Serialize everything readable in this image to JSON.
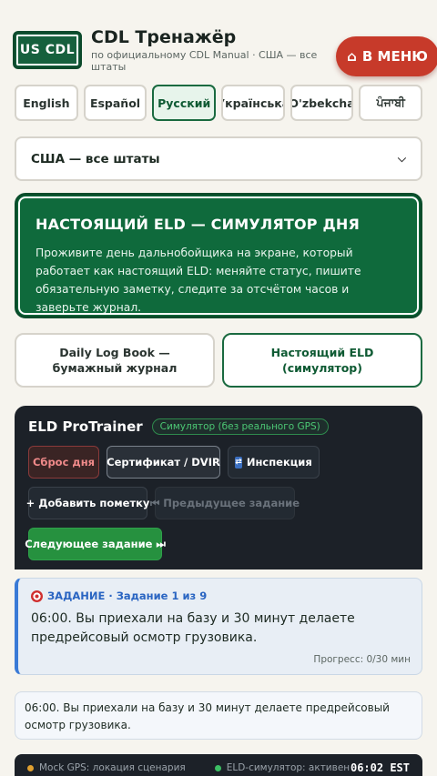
{
  "header": {
    "logo": "US CDL",
    "title": "CDL Тренажёр",
    "subtitle": "по официальному CDL Manual · США — все штаты",
    "menu_label": "В МЕНЮ",
    "menu_icon": "home-icon"
  },
  "languages": [
    {
      "label": "English",
      "active": false
    },
    {
      "label": "Español",
      "active": false
    },
    {
      "label": "Русский",
      "active": true
    },
    {
      "label": "Українська",
      "active": false
    },
    {
      "label": "O'zbekcha",
      "active": false
    },
    {
      "label": "ਪੰਜਾਬੀ",
      "active": false
    }
  ],
  "state_select": {
    "value": "США — все штаты"
  },
  "hero": {
    "title": "НАСТОЯЩИЙ ELD — СИМУЛЯТОР ДНЯ",
    "text": "Проживите день дальнобойщика на экране, который работает как настоящий ELD: меняйте статус, пишите обязательную заметку, следите за отсчётом часов и заверьте журнал."
  },
  "modes": {
    "paper": "Daily Log Book — бумажный журнал",
    "eld": "Настоящий ELD (симулятор)"
  },
  "eld": {
    "title": "ELD ProTrainer",
    "badge": "Симулятор (без реального GPS)",
    "reset": "Сброс дня",
    "cert": "Сертификат / DVIR",
    "inspection": "Инспекция",
    "add_note": "+ Добавить пометку",
    "prev": "⏮ Предыдущее задание",
    "next": "Следующее задание ⏭"
  },
  "task": {
    "heading": "ЗАДАНИЕ · Задание 1 из 9",
    "text": "06:00. Вы приехали на базу и 30 минут делаете предрейсовый осмотр грузовика.",
    "progress": "Прогресс: 0/30 мин"
  },
  "info_text": "06:00. Вы приехали на базу и 30 минут делаете предрейсовый осмотр грузовика.",
  "statusbar": {
    "gps": "Mock GPS: локация сценария",
    "gps_color": "#e0a030",
    "eld_status": "ELD-симулятор: активен",
    "eld_color": "#3cbf64",
    "clock": "06:02 EST"
  }
}
